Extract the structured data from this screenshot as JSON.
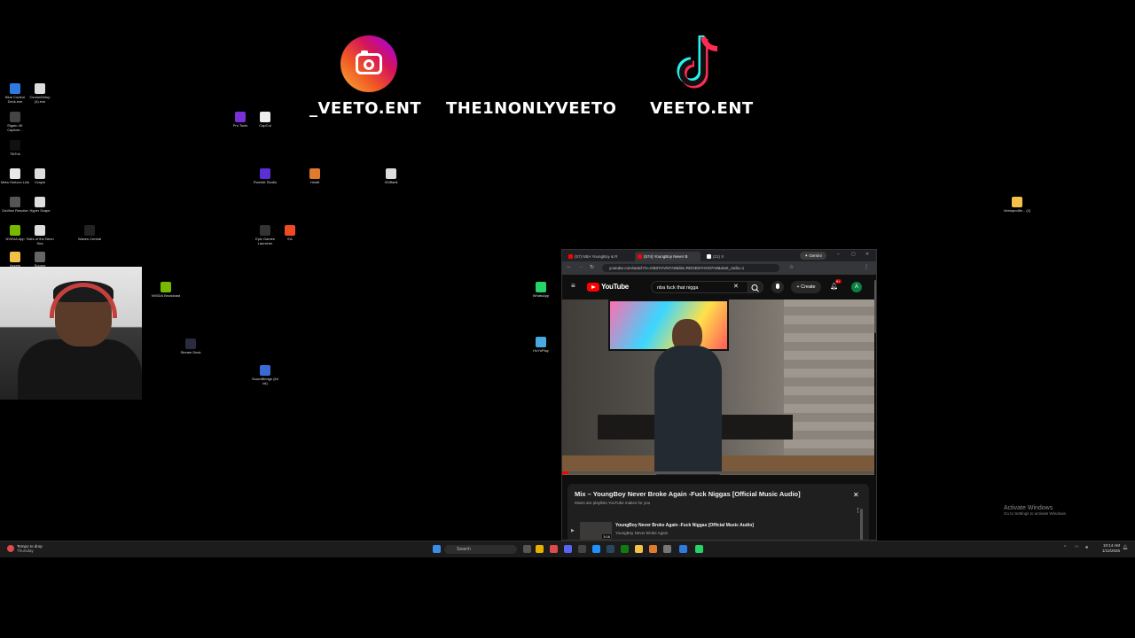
{
  "overlay": {
    "instagram_handle": "_VEETO.ENT",
    "youtube_handle": "THE1NONLYVEETO",
    "tiktok_handle": "VEETO.ENT"
  },
  "desktop_icons": [
    {
      "label": "Blue Control Deck.exe",
      "icon": "app-icon",
      "color": "#2d7be0"
    },
    {
      "label": "OculusSetup (4).exe",
      "icon": "file-icon",
      "color": "#dddddd"
    },
    {
      "label": "Elgato 4K Capture...",
      "icon": "app-icon",
      "color": "#444444"
    },
    {
      "label": "TikTok",
      "icon": "tiktok-icon",
      "color": "#111111"
    },
    {
      "label": "Meta Horizon Link",
      "icon": "app-icon",
      "color": "#e8e8e8"
    },
    {
      "label": "Crayta",
      "icon": "file-icon",
      "color": "#dddddd"
    },
    {
      "label": "DaVinci Resolve",
      "icon": "app-icon",
      "color": "#555555"
    },
    {
      "label": "Hyper Scape",
      "icon": "file-icon",
      "color": "#dddddd"
    },
    {
      "label": "NVIDIA App",
      "icon": "nvidia-icon",
      "color": "#76b900"
    },
    {
      "label": "Tales of the Neon Sea",
      "icon": "file-icon",
      "color": "#dddddd"
    },
    {
      "label": "Waves Central",
      "icon": "waves-icon",
      "color": "#222222"
    },
    {
      "label": "Assets",
      "icon": "folder-icon",
      "color": "#f3c14a"
    },
    {
      "label": "Source",
      "icon": "app-icon",
      "color": "#666666"
    },
    {
      "label": "Pro Tools",
      "icon": "protools-icon",
      "color": "#7b2fd6"
    },
    {
      "label": "CapCut",
      "icon": "capcut-icon",
      "color": "#eeeeee"
    },
    {
      "label": "Rumble Studio",
      "icon": "app-icon",
      "color": "#5a2fd6"
    },
    {
      "label": "Hostit",
      "icon": "app-icon",
      "color": "#e07b2d"
    },
    {
      "label": "XDiffanit",
      "icon": "file-icon",
      "color": "#dddddd"
    },
    {
      "label": "Epic Games Launcher",
      "icon": "epic-icon",
      "color": "#333333"
    },
    {
      "label": "EA",
      "icon": "ea-icon",
      "color": "#f04a24"
    },
    {
      "label": "NVIDIA Broadcast",
      "icon": "nvidia-icon",
      "color": "#76b900"
    },
    {
      "label": "Stream Deck",
      "icon": "streamdeck-icon",
      "color": "#2a2a40"
    },
    {
      "label": "SoundBridge (64 bit)",
      "icon": "soundbridge-icon",
      "color": "#3a6ad6"
    },
    {
      "label": "WhatsApp",
      "icon": "whatsapp-icon",
      "color": "#25d366"
    },
    {
      "label": "HoYoPlay",
      "icon": "app-icon",
      "color": "#4aa8e0"
    },
    {
      "label": "Veetoprofile... (2)",
      "icon": "folder-icon",
      "color": "#f3c14a"
    }
  ],
  "browser": {
    "tabs": [
      {
        "label": "(57) NBA YoungBoy & R",
        "active": false
      },
      {
        "label": "(574) YoungBoy Never B",
        "active": true
      },
      {
        "label": "(21) X",
        "active": false
      }
    ],
    "gemini_label": "Gemini",
    "url": "youtube.com/watch?v=GB3YHVN7A8&list=RDGB3YHVN7A8&start_radio=1",
    "youtube_logo": "YouTube",
    "search_query": "nba fuck that nigga",
    "create_label": "Create",
    "notif_badge": "9+",
    "avatar_letter": "A",
    "playlist": {
      "title": "Mix – YoungBoy Never Broke Again -Fuck Niggas [Official Music Audio]",
      "subtitle": "Mixes are playlists YouTube makes for you",
      "item_title": "YoungBoy Never Broke Again -Fuck Niggas [Official Music Audio]",
      "item_channel": "YoungBoy Never Broke Again",
      "item_duration": "3:16"
    }
  },
  "taskbar": {
    "weather_line1": "Tempo to drop",
    "weather_line2": "Thursday",
    "search_placeholder": "Search",
    "time": "10:14 AM",
    "date": "1/12/2026"
  },
  "watermark": {
    "title": "Activate Windows",
    "subtitle": "Go to Settings to activate Windows."
  }
}
